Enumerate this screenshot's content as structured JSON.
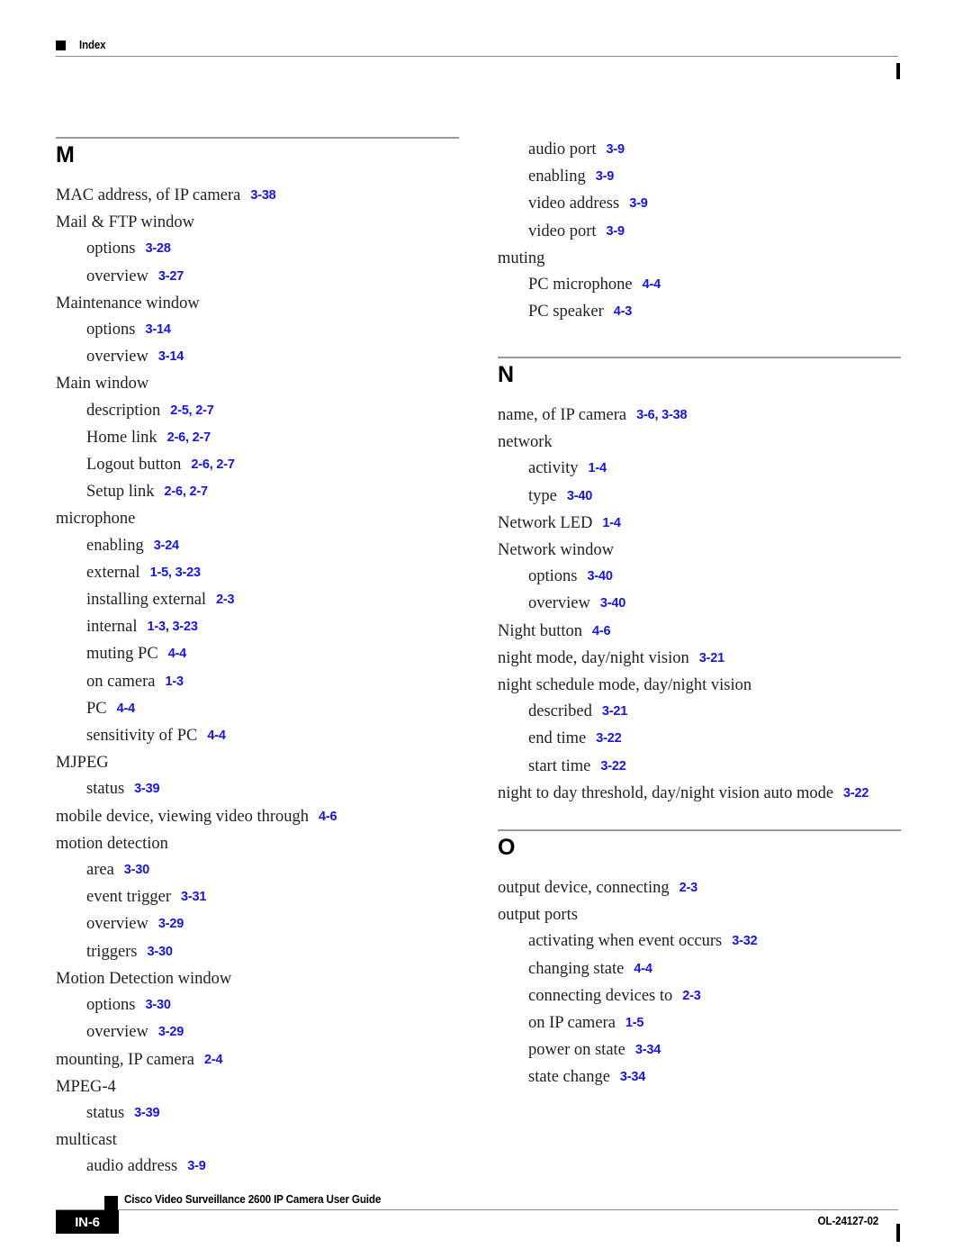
{
  "header": {
    "label": "Index",
    "bullet_icon": "black-square-icon"
  },
  "accent_colors": {
    "page_ref_blue": "#1414EF",
    "rule_gray": "#8A8A8A",
    "text_black": "#231F20"
  },
  "columns": {
    "left": {
      "sections": [
        {
          "letter": "M",
          "has_rule": true,
          "entries": [
            {
              "level": 1,
              "term": "MAC address, of IP camera",
              "pages": "3-38"
            },
            {
              "level": 1,
              "term": "Mail & FTP window",
              "pages": ""
            },
            {
              "level": 2,
              "term": "options",
              "pages": "3-28"
            },
            {
              "level": 2,
              "term": "overview",
              "pages": "3-27"
            },
            {
              "level": 1,
              "term": "Maintenance window",
              "pages": ""
            },
            {
              "level": 2,
              "term": "options",
              "pages": "3-14"
            },
            {
              "level": 2,
              "term": "overview",
              "pages": "3-14"
            },
            {
              "level": 1,
              "term": "Main window",
              "pages": ""
            },
            {
              "level": 2,
              "term": "description",
              "pages": "2-5, 2-7"
            },
            {
              "level": 2,
              "term": "Home link",
              "pages": "2-6, 2-7"
            },
            {
              "level": 2,
              "term": "Logout button",
              "pages": "2-6, 2-7"
            },
            {
              "level": 2,
              "term": "Setup link",
              "pages": "2-6, 2-7"
            },
            {
              "level": 1,
              "term": "microphone",
              "pages": ""
            },
            {
              "level": 2,
              "term": "enabling",
              "pages": "3-24"
            },
            {
              "level": 2,
              "term": "external",
              "pages": "1-5, 3-23"
            },
            {
              "level": 2,
              "term": "installing external",
              "pages": "2-3"
            },
            {
              "level": 2,
              "term": "internal",
              "pages": "1-3, 3-23"
            },
            {
              "level": 2,
              "term": "muting PC",
              "pages": "4-4"
            },
            {
              "level": 2,
              "term": "on camera",
              "pages": "1-3"
            },
            {
              "level": 2,
              "term": "PC",
              "pages": "4-4"
            },
            {
              "level": 2,
              "term": "sensitivity of PC",
              "pages": "4-4"
            },
            {
              "level": 1,
              "term": "MJPEG",
              "pages": ""
            },
            {
              "level": 2,
              "term": "status",
              "pages": "3-39"
            },
            {
              "level": 1,
              "term": "mobile device, viewing video through",
              "pages": "4-6"
            },
            {
              "level": 1,
              "term": "motion detection",
              "pages": ""
            },
            {
              "level": 2,
              "term": "area",
              "pages": "3-30"
            },
            {
              "level": 2,
              "term": "event trigger",
              "pages": "3-31"
            },
            {
              "level": 2,
              "term": "overview",
              "pages": "3-29"
            },
            {
              "level": 2,
              "term": "triggers",
              "pages": "3-30"
            },
            {
              "level": 1,
              "term": "Motion Detection window",
              "pages": ""
            },
            {
              "level": 2,
              "term": "options",
              "pages": "3-30"
            },
            {
              "level": 2,
              "term": "overview",
              "pages": "3-29"
            },
            {
              "level": 1,
              "term": "mounting, IP camera",
              "pages": "2-4"
            },
            {
              "level": 1,
              "term": "MPEG-4",
              "pages": ""
            },
            {
              "level": 2,
              "term": "status",
              "pages": "3-39"
            },
            {
              "level": 1,
              "term": "multicast",
              "pages": ""
            },
            {
              "level": 2,
              "term": "audio address",
              "pages": "3-9"
            }
          ]
        }
      ]
    },
    "right": {
      "continuation_entries": [
        {
          "level": 2,
          "term": "audio port",
          "pages": "3-9"
        },
        {
          "level": 2,
          "term": "enabling",
          "pages": "3-9"
        },
        {
          "level": 2,
          "term": "video address",
          "pages": "3-9"
        },
        {
          "level": 2,
          "term": "video port",
          "pages": "3-9"
        },
        {
          "level": 1,
          "term": "muting",
          "pages": ""
        },
        {
          "level": 2,
          "term": "PC microphone",
          "pages": "4-4"
        },
        {
          "level": 2,
          "term": "PC speaker",
          "pages": "4-3"
        }
      ],
      "sections": [
        {
          "letter": "N",
          "has_rule": true,
          "entries": [
            {
              "level": 1,
              "term": "name, of IP camera",
              "pages": "3-6, 3-38"
            },
            {
              "level": 1,
              "term": "network",
              "pages": ""
            },
            {
              "level": 2,
              "term": "activity",
              "pages": "1-4"
            },
            {
              "level": 2,
              "term": "type",
              "pages": "3-40"
            },
            {
              "level": 1,
              "term": "Network LED",
              "pages": "1-4"
            },
            {
              "level": 1,
              "term": "Network window",
              "pages": ""
            },
            {
              "level": 2,
              "term": "options",
              "pages": "3-40"
            },
            {
              "level": 2,
              "term": "overview",
              "pages": "3-40"
            },
            {
              "level": 1,
              "term": "Night button",
              "pages": "4-6"
            },
            {
              "level": 1,
              "term": "night mode, day/night vision",
              "pages": "3-21"
            },
            {
              "level": 1,
              "term": "night schedule mode, day/night vision",
              "pages": ""
            },
            {
              "level": 2,
              "term": "described",
              "pages": "3-21"
            },
            {
              "level": 2,
              "term": "end time",
              "pages": "3-22"
            },
            {
              "level": 2,
              "term": "start time",
              "pages": "3-22"
            },
            {
              "level": 1,
              "term": "night to day threshold, day/night vision auto mode",
              "pages": "3-22"
            }
          ]
        },
        {
          "letter": "O",
          "has_rule": true,
          "entries": [
            {
              "level": 1,
              "term": "output device, connecting",
              "pages": "2-3"
            },
            {
              "level": 1,
              "term": "output ports",
              "pages": ""
            },
            {
              "level": 2,
              "term": "activating when event occurs",
              "pages": "3-32"
            },
            {
              "level": 2,
              "term": "changing state",
              "pages": "4-4"
            },
            {
              "level": 2,
              "term": "connecting devices to",
              "pages": "2-3"
            },
            {
              "level": 2,
              "term": "on IP camera",
              "pages": "1-5"
            },
            {
              "level": 2,
              "term": "power on state",
              "pages": "3-34"
            },
            {
              "level": 2,
              "term": "state change",
              "pages": "3-34"
            }
          ]
        }
      ]
    },
    "right_section_tops": [
      396,
      921
    ]
  },
  "footer": {
    "page_badge": "IN-6",
    "title": "Cisco Video Surveillance 2600 IP Camera User Guide",
    "doc_id": "OL-24127-02",
    "bullet_icon": "black-square-icon"
  }
}
